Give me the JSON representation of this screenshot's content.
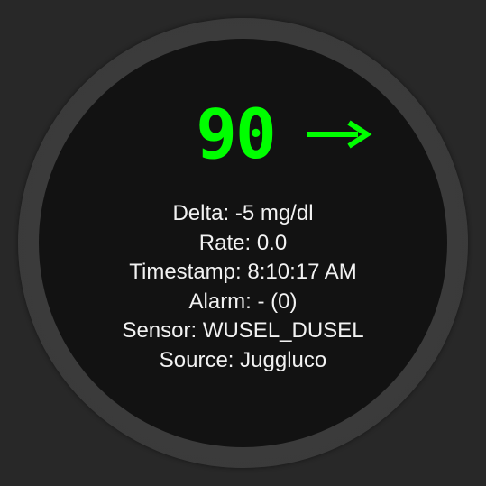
{
  "glucose": {
    "value": "90",
    "trend_icon": "arrow-right-icon",
    "color": "#00ff00"
  },
  "info": {
    "delta": "Delta: -5 mg/dl",
    "rate": "Rate: 0.0",
    "timestamp": "Timestamp: 8:10:17 AM",
    "alarm": "Alarm: - (0)",
    "sensor": "Sensor: WUSEL_DUSEL",
    "source": "Source: Juggluco"
  }
}
